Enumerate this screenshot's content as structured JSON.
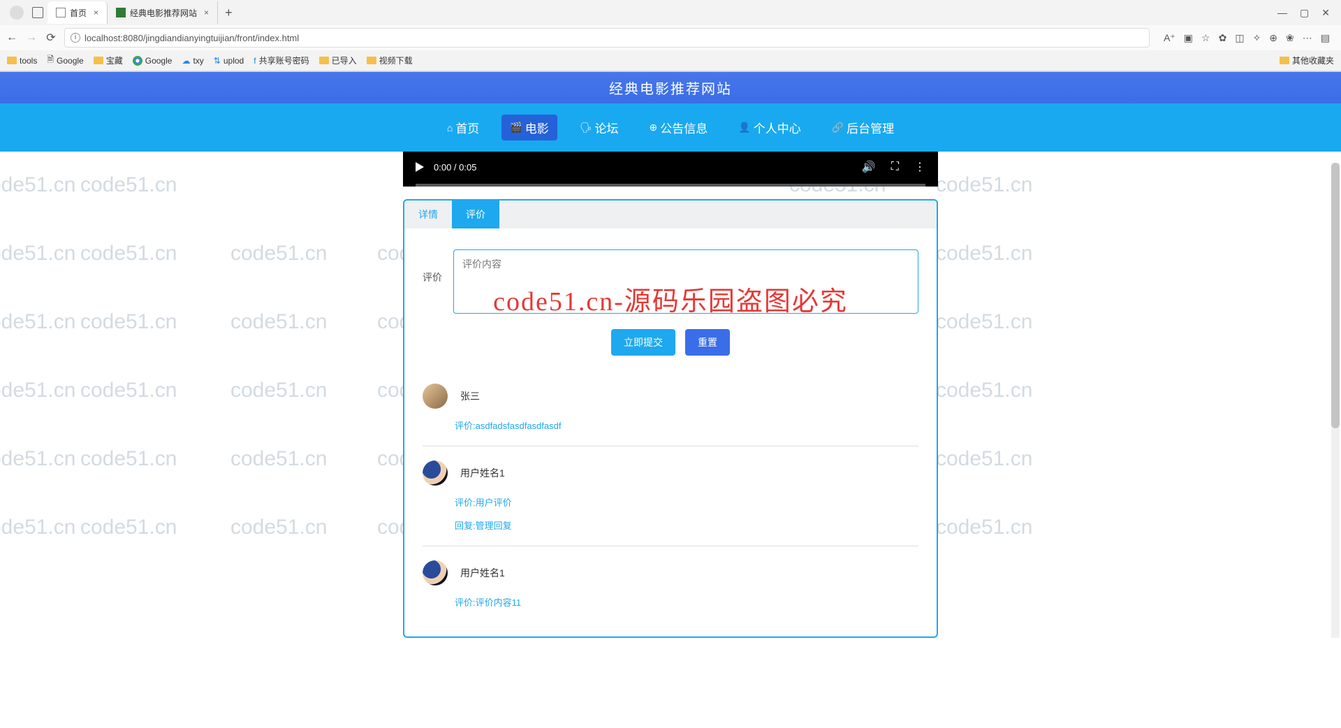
{
  "browser": {
    "tabs": [
      {
        "title": "首页",
        "active": true
      },
      {
        "title": "经典电影推荐网站",
        "active": false
      }
    ],
    "url": "localhost:8080/jingdiandianyingtuijian/front/index.html",
    "bookmarks": [
      "tools",
      "Google",
      "宝藏",
      "Google",
      "txy",
      "uplod",
      "共享账号密码",
      "已导入",
      "视频下载"
    ],
    "bookmarks_right": "其他收藏夹"
  },
  "site": {
    "title": "经典电影推荐网站",
    "nav": [
      {
        "icon": "⌂",
        "label": "首页"
      },
      {
        "icon": "🎬",
        "label": "电影",
        "active": true
      },
      {
        "icon": "🗣",
        "label": "论坛"
      },
      {
        "icon": "⊕",
        "label": "公告信息"
      },
      {
        "icon": "👤",
        "label": "个人中心"
      },
      {
        "icon": "🔗",
        "label": "后台管理"
      }
    ]
  },
  "video": {
    "time": "0:00 / 0:05"
  },
  "tabs": {
    "detail": "详情",
    "review": "评价"
  },
  "form": {
    "label": "评价",
    "placeholder": "评价内容",
    "submit": "立即提交",
    "reset": "重置"
  },
  "comments": [
    {
      "name": "张三",
      "lines": [
        "评价:asdfadsfasdfasdfasdf"
      ]
    },
    {
      "name": "用户姓名1",
      "lines": [
        "评价:用户评价",
        "回复:管理回复"
      ]
    },
    {
      "name": "用户姓名1",
      "lines": [
        "评价:评价内容11"
      ]
    }
  ],
  "watermark_text": "code51.cn",
  "overlay_text": "code51.cn-源码乐园盗图必究"
}
